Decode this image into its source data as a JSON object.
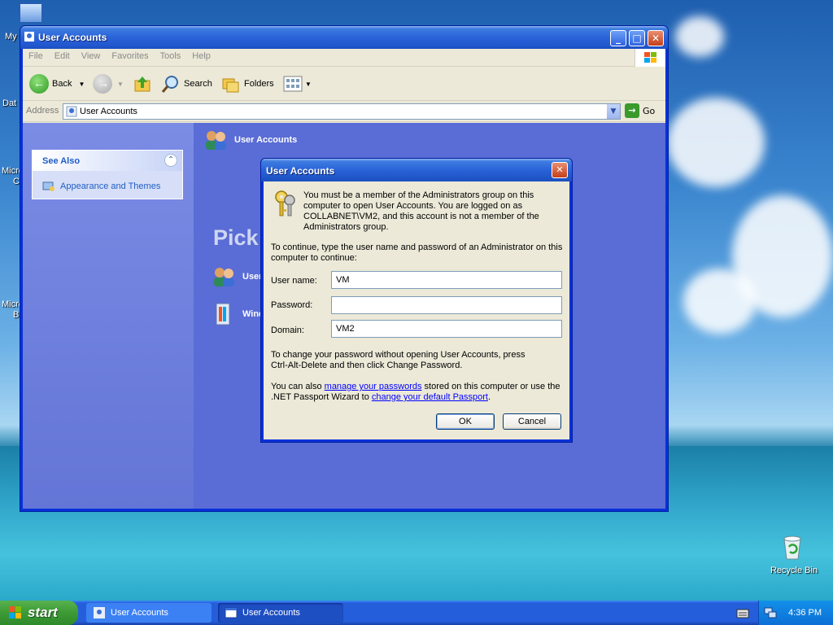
{
  "desktop": {
    "labels": [
      "My",
      "Dat",
      "Micro",
      "C",
      "Micro",
      "B"
    ],
    "recycle_bin": "Recycle Bin"
  },
  "window": {
    "title": "User Accounts",
    "menu": [
      "File",
      "Edit",
      "View",
      "Favorites",
      "Tools",
      "Help"
    ],
    "toolbar": {
      "back": "Back",
      "search": "Search",
      "folders": "Folders"
    },
    "address": {
      "label": "Address",
      "value": "User Accounts",
      "go": "Go"
    },
    "see_also": {
      "heading": "See Also",
      "link": "Appearance and Themes"
    },
    "main": {
      "heading": "User Accounts",
      "pick": "Pick",
      "task1": "User",
      "task2": "Wind"
    }
  },
  "dialog": {
    "title": "User Accounts",
    "message": "You must be a member of the Administrators group on this computer to open User Accounts.  You are logged on as COLLABNET\\VM2, and this account is not a member of the Administrators group.",
    "instruction": "To continue, type the user name and password of an Administrator on this computer to continue:",
    "fields": {
      "username_label": "User name:",
      "username_value": "VM",
      "password_label": "Password:",
      "password_value": "",
      "domain_label": "Domain:",
      "domain_value": "VM2"
    },
    "change_pw_text": "To change your password without opening User Accounts, press Ctrl-Alt-Delete and then click Change Password.",
    "also_prefix": "You can also ",
    "link1": "manage your passwords",
    "also_middle": " stored on this computer or use the .NET Passport Wizard to ",
    "link2": "change your default Passport",
    "also_suffix": ".",
    "ok": "OK",
    "cancel": "Cancel"
  },
  "taskbar": {
    "start": "start",
    "tasks": [
      "User Accounts",
      "User Accounts"
    ],
    "clock": "4:36 PM"
  }
}
